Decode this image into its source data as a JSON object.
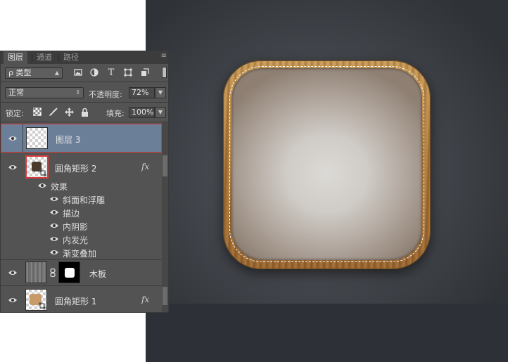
{
  "tabs": [
    {
      "label": "图层",
      "active": true
    },
    {
      "label": "通道",
      "active": false
    },
    {
      "label": "路径",
      "active": false
    }
  ],
  "panel_menu_icon": "≡",
  "filter": {
    "kind_label": "ρ 类型",
    "icons": [
      "image-filter-icon",
      "adjustment-filter-icon",
      "text-filter-icon",
      "shape-filter-icon",
      "smart-object-filter-icon"
    ],
    "text_icon_glyph": "T"
  },
  "blend": {
    "mode": "正常",
    "opacity_label": "不透明度:",
    "opacity_value": "72%"
  },
  "lock": {
    "label": "锁定:",
    "fill_label": "填充:",
    "fill_value": "100%"
  },
  "layers": [
    {
      "name": "图层 3",
      "selected": true,
      "highlight_color": "#6b7f99"
    },
    {
      "name": "圆角矩形 2",
      "fx": "fx",
      "effects_title": "效果",
      "effects": [
        "斜面和浮雕",
        "描边",
        "内阴影",
        "内发光",
        "渐变叠加"
      ]
    },
    {
      "name": "木板"
    },
    {
      "name": "圆角矩形 1",
      "fx": "fx"
    }
  ],
  "colors": {
    "highlight_border": "#d83b3b",
    "selected_row": "#6b7f99",
    "wood": "#b07b3c"
  }
}
